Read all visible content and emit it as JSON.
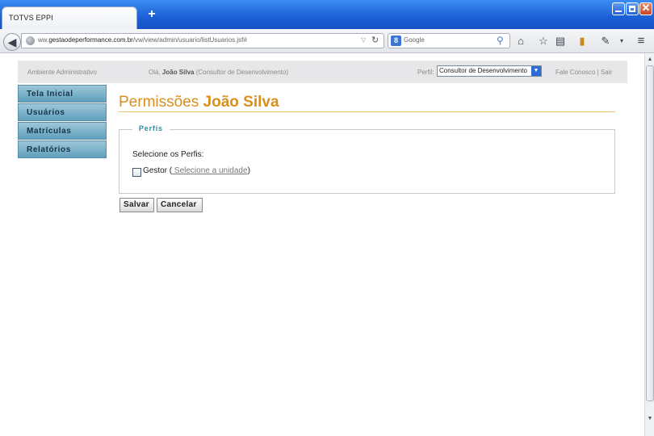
{
  "browser": {
    "tab_title": "TOTVS EPPI",
    "new_tab": "+",
    "url_prefix": "ww.",
    "url_domain": "gestaodeperformance.com.br",
    "url_path": "/vw/view/admin/usuario/listUsuarios.jsf#",
    "search_engine_icon": "8",
    "search_placeholder": "Google"
  },
  "header": {
    "environment": "Ambiente Administrativo",
    "greeting_prefix": "Olá,",
    "user_name": "João Silva",
    "user_role": "(Consultor de Desenvolvimento)",
    "perfil_label": "Perfil:",
    "perfil_selected": "Consultor de Desenvolvimento",
    "link_contact": "Fale Conosco",
    "link_separator": "|",
    "link_logout": "Sair"
  },
  "sidebar": {
    "items": [
      {
        "label": "Tela Inicial"
      },
      {
        "label": "Usuários"
      },
      {
        "label": "Matrículas"
      },
      {
        "label": "Relatórios"
      }
    ]
  },
  "main": {
    "title_prefix": "Permissões",
    "title_name": "João Silva",
    "fieldset_legend": "Perfis",
    "select_label": "Selecione os Perfis:",
    "profile_option": "Gestor",
    "profile_open_paren": "(",
    "profile_link": " Selecione a unidade",
    "profile_close_paren": ")",
    "profile_checked": false
  },
  "buttons": {
    "save": "Salvar",
    "cancel": "Cancelar"
  },
  "colors": {
    "title_accent": "#d98f1f",
    "menu_bg": "#5f9fbd",
    "legend_color": "#2b8b9e",
    "browser_chrome": "#1c5fd6"
  }
}
